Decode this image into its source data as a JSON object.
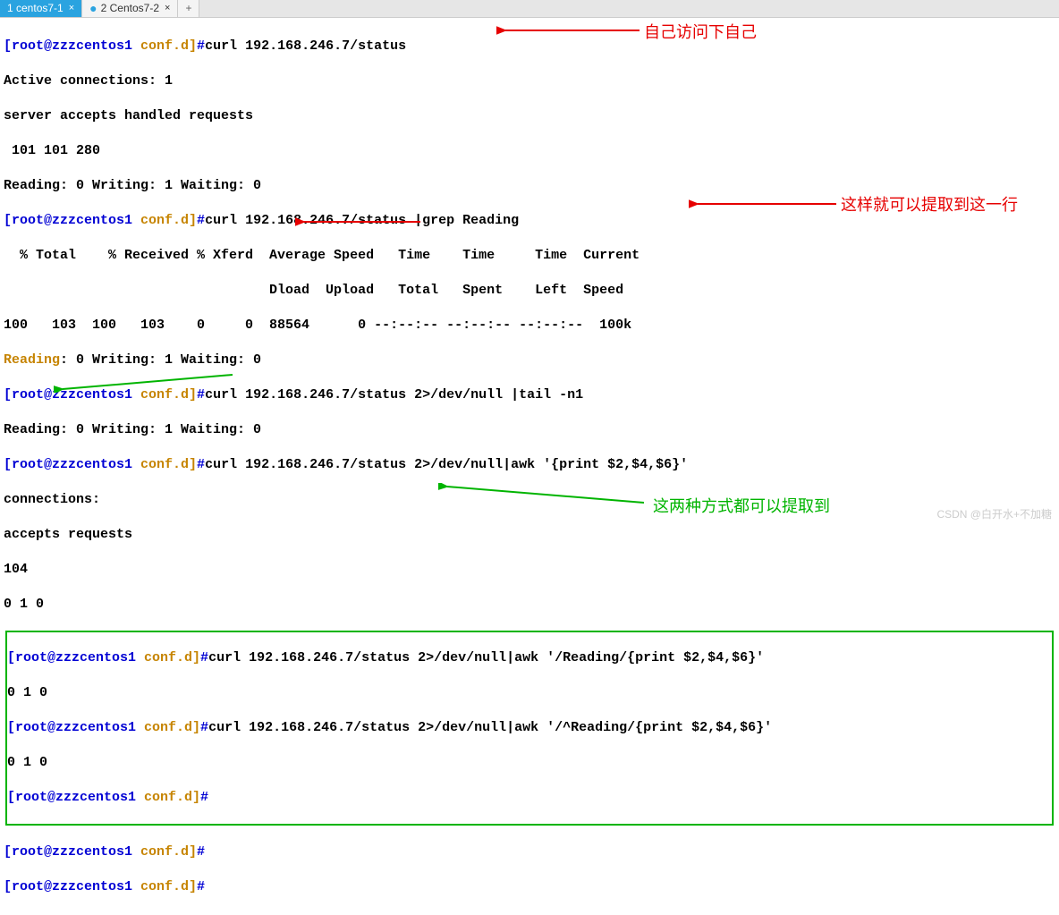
{
  "tabs": {
    "active": "1 centos7-1",
    "inactive": "2 Centos7-2"
  },
  "prompt": {
    "user_host": "[root@zzzcentos1 ",
    "path": "conf.d]",
    "hash": "#"
  },
  "cmds": {
    "c1": "curl 192.168.246.7/status",
    "c2": "curl 192.168.246.7/status |grep Reading",
    "c3": "curl 192.168.246.7/status 2>/dev/null |tail -n1",
    "c4": "curl 192.168.246.7/status 2>/dev/null|awk '{print $2,$4,$6}'",
    "c5": "curl 192.168.246.7/status 2>/dev/null|awk '/Reading/{print $2,$4,$6}'",
    "c6": "curl 192.168.246.7/status 2>/dev/null|awk '/^Reading/{print $2,$4,$6}'"
  },
  "out": {
    "o1a": "Active connections: 1 ",
    "o1b": "server accepts handled requests",
    "o1c": " 101 101 280 ",
    "o1d": "Reading: 0 Writing: 1 Waiting: 0 ",
    "o2a": "  % Total    % Received % Xferd  Average Speed   Time    Time     Time  Current",
    "o2b": "                                 Dload  Upload   Total   Spent    Left  Speed",
    "o2c": "100   103  100   103    0     0  88564      0 --:--:-- --:--:-- --:--:--  100k",
    "o2d_prefix": "Reading",
    "o2d_rest": ": 0 Writing: 1 Waiting: 0 ",
    "o3a": "Reading: 0 Writing: 1 Waiting: 0 ",
    "o4a": "connections:",
    "o4b": "accepts requests",
    "o4c": "104",
    "o4d": "0 1 0",
    "o5a": "0 1 0",
    "o6a": "0 1 0"
  },
  "annotations": {
    "a1": "自己访问下自己",
    "a2": "这样就可以提取到这一行",
    "a3": "这两种方式都可以提取到"
  },
  "watermark": "CSDN @白开水+不加糖"
}
